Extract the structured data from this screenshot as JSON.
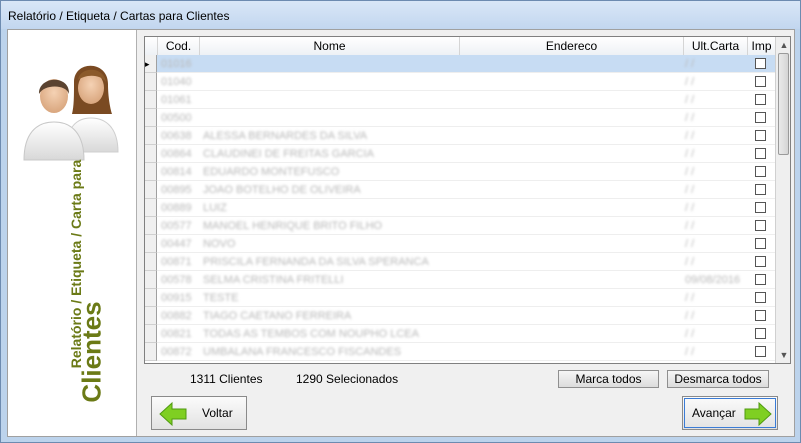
{
  "window": {
    "title": "Relatório / Etiqueta / Cartas para Clientes"
  },
  "sidebar": {
    "subtitle": "Relatório / Etiqueta / Carta para",
    "title": "Clientes",
    "accent_color": "#6b7a16"
  },
  "grid": {
    "columns": [
      "Cod.",
      "Nome",
      "Endereco",
      "Ult.Carta",
      "Imp"
    ],
    "rows": [
      {
        "cod": "01016",
        "nome": "",
        "endereco": "",
        "ult": "/ /"
      },
      {
        "cod": "01040",
        "nome": "",
        "endereco": "",
        "ult": "/ /"
      },
      {
        "cod": "01061",
        "nome": "",
        "endereco": "",
        "ult": "/ /"
      },
      {
        "cod": "00500",
        "nome": "",
        "endereco": "",
        "ult": "/ /"
      },
      {
        "cod": "00638",
        "nome": "ALESSA BERNARDES DA SILVA",
        "endereco": "",
        "ult": "/ /"
      },
      {
        "cod": "00864",
        "nome": "CLAUDINEI DE FREITAS GARCIA",
        "endereco": "",
        "ult": "/ /"
      },
      {
        "cod": "00814",
        "nome": "EDUARDO MONTEFUSCO",
        "endereco": "",
        "ult": "/ /"
      },
      {
        "cod": "00895",
        "nome": "JOAO BOTELHO DE OLIVEIRA",
        "endereco": "",
        "ult": "/ /"
      },
      {
        "cod": "00889",
        "nome": "LUIZ",
        "endereco": "",
        "ult": "/ /"
      },
      {
        "cod": "00577",
        "nome": "MANOEL HENRIQUE BRITO FILHO",
        "endereco": "",
        "ult": "/ /"
      },
      {
        "cod": "00447",
        "nome": "NOVO",
        "endereco": "",
        "ult": "/ /"
      },
      {
        "cod": "00871",
        "nome": "PRISCILA FERNANDA DA SILVA SPERANCA",
        "endereco": "",
        "ult": "/ /"
      },
      {
        "cod": "00578",
        "nome": "SELMA CRISTINA FRITELLI",
        "endereco": "",
        "ult": "09/08/2016"
      },
      {
        "cod": "00915",
        "nome": "TESTE",
        "endereco": "",
        "ult": "/ /"
      },
      {
        "cod": "00882",
        "nome": "TIAGO CAETANO FERREIRA",
        "endereco": "",
        "ult": "/ /"
      },
      {
        "cod": "00821",
        "nome": "TODAS AS TEMBOS COM NOUPHO LCEA",
        "endereco": "",
        "ult": "/ /"
      },
      {
        "cod": "00872",
        "nome": "UMBALANA FRANCESCO FISCANDES",
        "endereco": "",
        "ult": "/ /"
      }
    ]
  },
  "footer": {
    "clients_count": "1311 Clientes",
    "selected_count": "1290 Selecionados",
    "mark_all": "Marca todos",
    "unmark_all": "Desmarca todos",
    "back": "Voltar",
    "next": "Avançar"
  }
}
